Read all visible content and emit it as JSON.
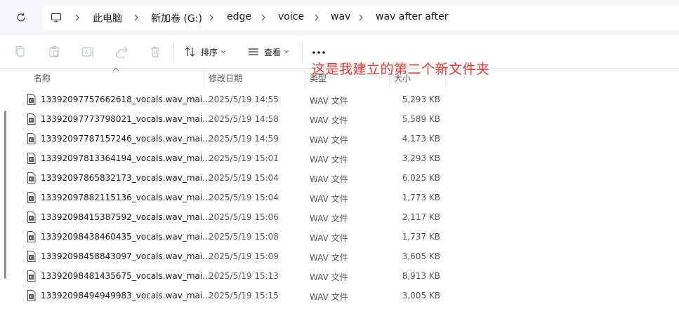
{
  "breadcrumb": [
    "此电脑",
    "新加卷 (G:)",
    "edge",
    "voice",
    "wav",
    "wav after after"
  ],
  "toolbar": {
    "sort_label": "排序",
    "view_label": "查看"
  },
  "annotation": "这是我建立的第二个新文件夹",
  "columns": {
    "name": "名称",
    "date": "修改日期",
    "type": "类型",
    "size": "大小"
  },
  "files": [
    {
      "name": "13392097757662618_vocals.wav_mai...",
      "date": "2025/5/19 14:55",
      "type": "WAV 文件",
      "size": "5,293 KB"
    },
    {
      "name": "13392097773798021_vocals.wav_mai...",
      "date": "2025/5/19 14:58",
      "type": "WAV 文件",
      "size": "5,589 KB"
    },
    {
      "name": "13392097787157246_vocals.wav_mai...",
      "date": "2025/5/19 14:59",
      "type": "WAV 文件",
      "size": "4,173 KB"
    },
    {
      "name": "13392097813364194_vocals.wav_mai...",
      "date": "2025/5/19 15:01",
      "type": "WAV 文件",
      "size": "3,293 KB"
    },
    {
      "name": "13392097865832173_vocals.wav_mai...",
      "date": "2025/5/19 15:04",
      "type": "WAV 文件",
      "size": "6,025 KB"
    },
    {
      "name": "13392097882115136_vocals.wav_mai...",
      "date": "2025/5/19 15:04",
      "type": "WAV 文件",
      "size": "1,773 KB"
    },
    {
      "name": "13392098415387592_vocals.wav_mai...",
      "date": "2025/5/19 15:06",
      "type": "WAV 文件",
      "size": "2,117 KB"
    },
    {
      "name": "13392098438460435_vocals.wav_mai...",
      "date": "2025/5/19 15:08",
      "type": "WAV 文件",
      "size": "1,737 KB"
    },
    {
      "name": "13392098458843097_vocals.wav_mai...",
      "date": "2025/5/19 15:09",
      "type": "WAV 文件",
      "size": "3,605 KB"
    },
    {
      "name": "13392098481435675_vocals.wav_mai...",
      "date": "2025/5/19 15:13",
      "type": "WAV 文件",
      "size": "8,913 KB"
    },
    {
      "name": "13392098494949983_vocals.wav_mai...",
      "date": "2025/5/19 15:15",
      "type": "WAV 文件",
      "size": "3,005 KB"
    }
  ]
}
